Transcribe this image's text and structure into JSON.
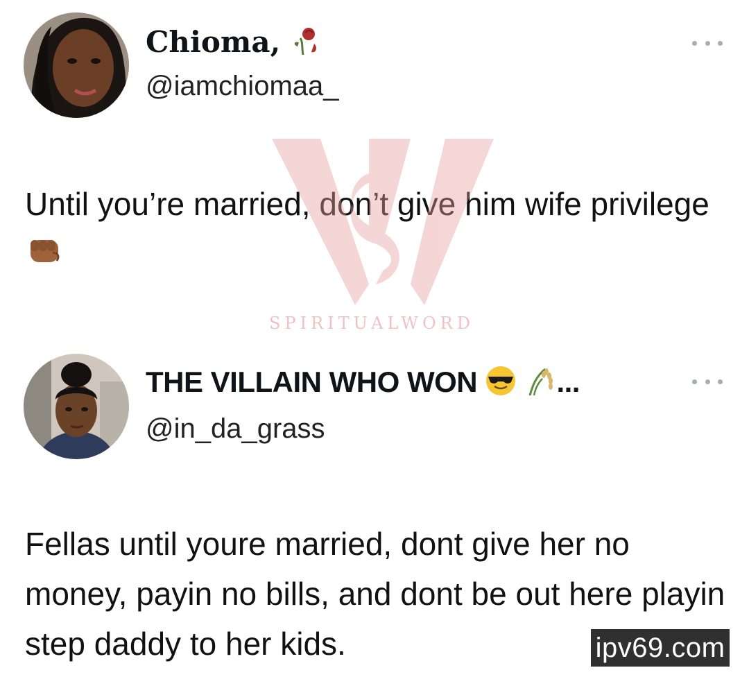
{
  "tweets": [
    {
      "display_name": "Chioma",
      "handle": "@iamchiomaa_",
      "name_emoji": "wilted-rose-emoji",
      "text": "Until you’re married, don’t give him wife privilege",
      "text_emoji": "fist-emoji"
    },
    {
      "display_name": "THE VILLAIN WHO WON",
      "handle": "@in_da_grass",
      "name_emoji": "sunglasses-emoji, rice-stalk-emoji",
      "name_ellipsis": "...",
      "text": "Fellas until youre married, dont give her no money, payin no bills, and dont be out here playin step daddy to her kids."
    }
  ],
  "watermark": {
    "text": "SPIRITUALWORD",
    "color": "#e39a9a"
  },
  "site_badge": {
    "text": "ipv69.com"
  }
}
